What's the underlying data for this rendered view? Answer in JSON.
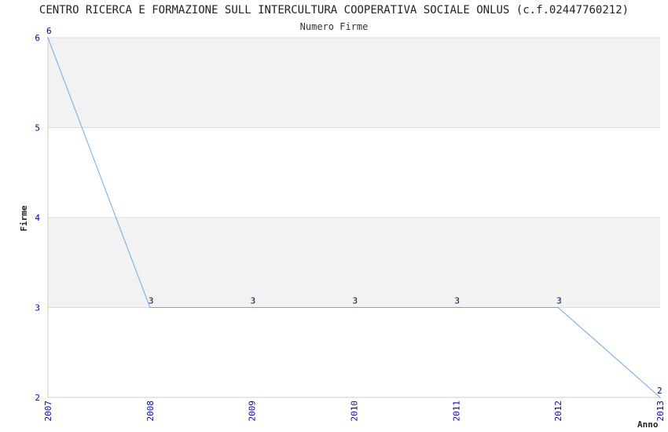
{
  "chart_data": {
    "type": "line",
    "title": "CENTRO RICERCA E FORMAZIONE SULL INTERCULTURA COOPERATIVA SOCIALE ONLUS (c.f.02447760212)",
    "subtitle": "Numero Firme",
    "xlabel": "Anno",
    "ylabel": "Firme",
    "categories": [
      "2007",
      "2008",
      "2009",
      "2010",
      "2011",
      "2012",
      "2013"
    ],
    "series": [
      {
        "values": [
          6,
          3,
          3,
          3,
          3,
          3,
          2
        ]
      }
    ],
    "data_labels": [
      "6",
      "3",
      "3",
      "3",
      "3",
      "3",
      "2"
    ],
    "yticks": [
      "2",
      "3",
      "4",
      "5",
      "6"
    ],
    "ylim": [
      2,
      6
    ],
    "grid": true,
    "colors": {
      "line": "#6aa9ee",
      "band": "#f2f2f2",
      "grid": "#dddddd",
      "tick_text": "#0000cc",
      "label_text": "#000066"
    }
  }
}
